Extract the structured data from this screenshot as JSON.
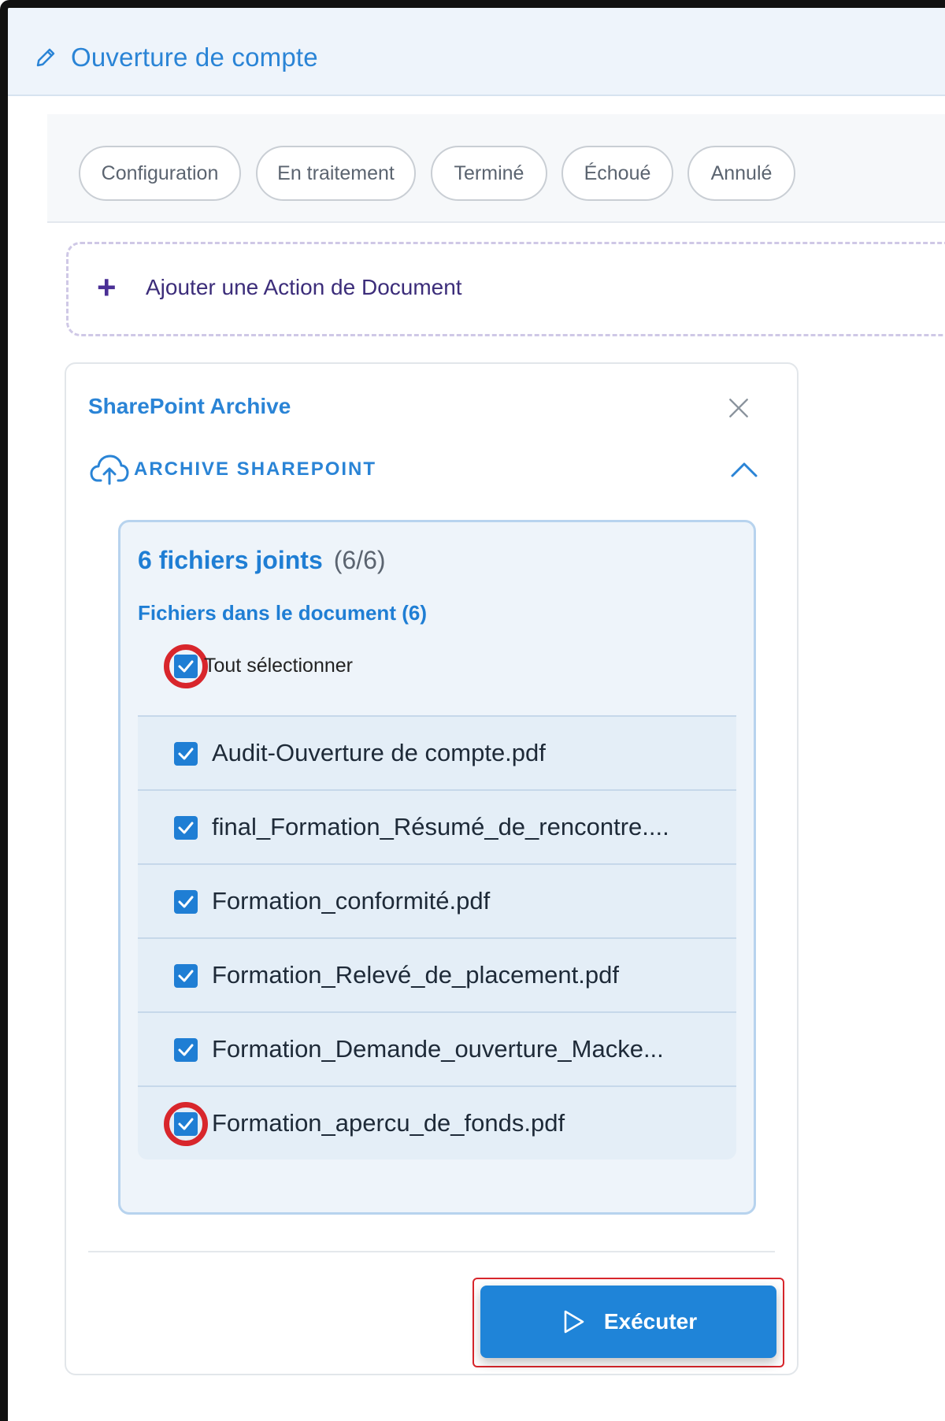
{
  "header": {
    "title": "Ouverture de compte",
    "edit_icon": "pencil-icon"
  },
  "status_tabs": [
    {
      "label": "Configuration"
    },
    {
      "label": "En traitement"
    },
    {
      "label": "Terminé"
    },
    {
      "label": "Échoué"
    },
    {
      "label": "Annulé"
    }
  ],
  "add_action": {
    "icon": "plus-icon",
    "label": "Ajouter une Action de Document"
  },
  "card": {
    "title": "SharePoint Archive",
    "close_icon": "close-icon",
    "section": {
      "icon": "cloud-upload-icon",
      "title": "ARCHIVE SHAREPOINT",
      "toggle_icon": "chevron-up-icon"
    },
    "attachments": {
      "count_label": "6 fichiers joints",
      "count_fraction": "(6/6)",
      "subtitle": "Fichiers dans le document (6)",
      "select_all_label": "Tout sélectionner",
      "select_all_checked": true,
      "files": [
        {
          "name": "Audit-Ouverture de compte.pdf",
          "checked": true
        },
        {
          "name": "final_Formation_Résumé_de_rencontre....",
          "checked": true
        },
        {
          "name": "Formation_conformité.pdf",
          "checked": true
        },
        {
          "name": "Formation_Relevé_de_placement.pdf",
          "checked": true
        },
        {
          "name": "Formation_Demande_ouverture_Macke...",
          "checked": true
        },
        {
          "name": "Formation_apercu_de_fonds.pdf",
          "checked": true
        }
      ]
    },
    "execute_button": {
      "label": "Exécuter",
      "icon": "play-icon"
    }
  },
  "colors": {
    "accent": "#1f84d8",
    "highlight": "#d8262c",
    "header_bg": "#eef4fb"
  }
}
